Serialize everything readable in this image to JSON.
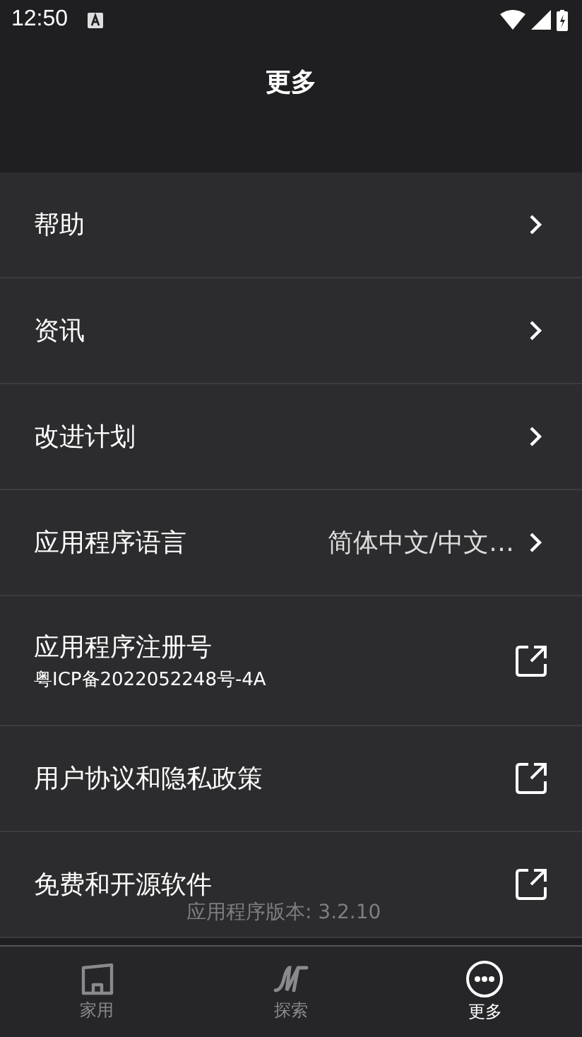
{
  "status_bar": {
    "time": "12:50"
  },
  "header": {
    "title": "更多"
  },
  "items": [
    {
      "kind": "arrow",
      "label": "帮助"
    },
    {
      "kind": "arrow",
      "label": "资讯"
    },
    {
      "kind": "arrow",
      "label": "改进计划"
    },
    {
      "kind": "arrow",
      "label": "应用程序语言",
      "value": "简体中文/中文…"
    },
    {
      "kind": "external",
      "label": "应用程序注册号",
      "subtitle": "粤ICP备2022052248号-4A"
    },
    {
      "kind": "external",
      "label": "用户协议和隐私政策"
    },
    {
      "kind": "external",
      "label": "免费和开源软件"
    }
  ],
  "version": "应用程序版本: 3.2.10",
  "tabs": [
    {
      "kind": "home",
      "label": "家用",
      "selected": false
    },
    {
      "kind": "explore",
      "label": "探索",
      "selected": false
    },
    {
      "kind": "more",
      "label": "更多",
      "selected": true
    }
  ]
}
